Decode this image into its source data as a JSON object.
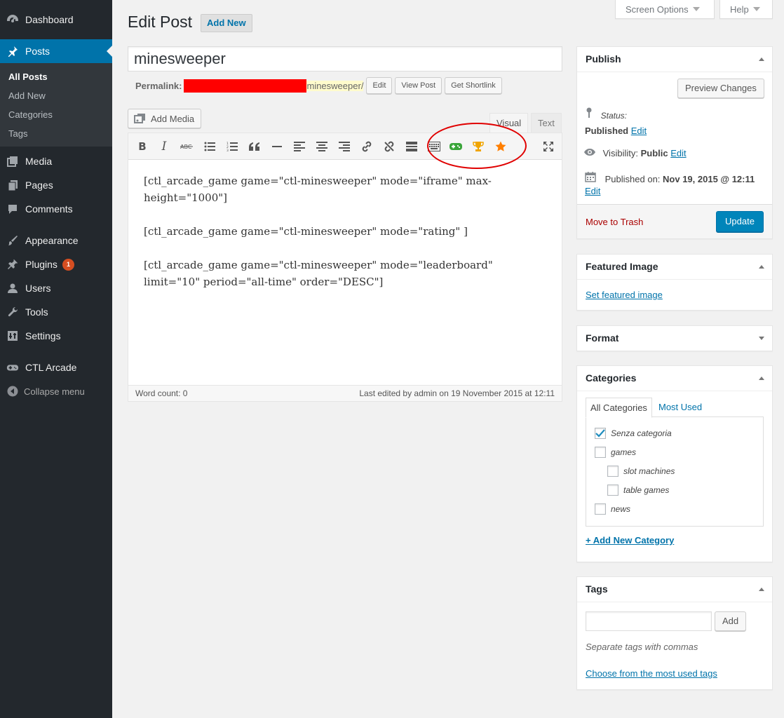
{
  "sidebar": {
    "items": [
      {
        "label": "Dashboard",
        "icon": "dashboard-icon"
      },
      {
        "label": "Posts",
        "icon": "pin-icon"
      },
      {
        "label": "Media",
        "icon": "media-icon"
      },
      {
        "label": "Pages",
        "icon": "pages-icon"
      },
      {
        "label": "Comments",
        "icon": "comments-icon"
      },
      {
        "label": "Appearance",
        "icon": "brush-icon"
      },
      {
        "label": "Plugins",
        "icon": "plugin-icon",
        "badge": "1"
      },
      {
        "label": "Users",
        "icon": "users-icon"
      },
      {
        "label": "Tools",
        "icon": "wrench-icon"
      },
      {
        "label": "Settings",
        "icon": "settings-icon"
      },
      {
        "label": "CTL Arcade",
        "icon": "gamepad-icon"
      },
      {
        "label": "Collapse menu",
        "icon": "collapse-icon"
      }
    ],
    "posts_submenu": [
      "All Posts",
      "Add New",
      "Categories",
      "Tags"
    ]
  },
  "screen_meta": {
    "screen_options": "Screen Options",
    "help": "Help"
  },
  "page": {
    "title": "Edit Post",
    "add_new": "Add New"
  },
  "post": {
    "title": "minesweeper",
    "permalink_label": "Permalink:",
    "slug": "minesweeper",
    "slug_suffix": "/",
    "edit_btn": "Edit",
    "view_btn": "View Post",
    "shortlink_btn": "Get Shortlink"
  },
  "editor": {
    "add_media": "Add Media",
    "tab_visual": "Visual",
    "tab_text": "Text",
    "content": [
      "[ctl_arcade_game game=\"ctl-minesweeper\" mode=\"iframe\" max-height=\"1000\"]",
      "[ctl_arcade_game game=\"ctl-minesweeper\" mode=\"rating\" ]",
      "[ctl_arcade_game game=\"ctl-minesweeper\" mode=\"leaderboard\" limit=\"10\" period=\"all-time\" order=\"DESC\"]"
    ],
    "word_count": "Word count: 0",
    "last_edited": "Last edited by admin on 19 November 2015 at 12:11",
    "colors": {
      "game_icon": "#3aa53a",
      "trophy_icon": "#f0a500",
      "star_icon": "#ff7f00",
      "highlight": "#e00000"
    }
  },
  "publish": {
    "title": "Publish",
    "preview": "Preview Changes",
    "status_label": "Status:",
    "status_value": "Published",
    "status_edit": "Edit",
    "visibility_label": "Visibility:",
    "visibility_value": "Public",
    "visibility_edit": "Edit",
    "published_on_label": "Published on:",
    "published_on_value": "Nov 19, 2015 @ 12:11",
    "published_edit": "Edit",
    "trash": "Move to Trash",
    "update": "Update"
  },
  "featured_image": {
    "title": "Featured Image",
    "link": "Set featured image"
  },
  "format": {
    "title": "Format"
  },
  "categories": {
    "title": "Categories",
    "tab_all": "All Categories",
    "tab_used": "Most Used",
    "items": [
      {
        "label": "Senza categoria",
        "checked": true
      },
      {
        "label": "games",
        "checked": false
      },
      {
        "label": "slot machines",
        "checked": false
      },
      {
        "label": "table games",
        "checked": false
      },
      {
        "label": "news",
        "checked": false
      }
    ],
    "add_new": "+ Add New Category"
  },
  "tags": {
    "title": "Tags",
    "add_btn": "Add",
    "hint": "Separate tags with commas",
    "choose_link": "Choose from the most used tags"
  }
}
